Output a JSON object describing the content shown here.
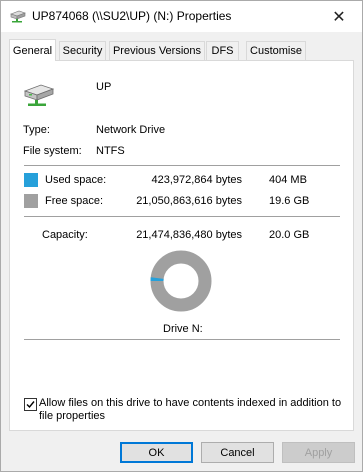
{
  "window": {
    "title": "UP874068 (\\\\SU2\\UP) (N:) Properties",
    "close_glyph": "✕"
  },
  "tabs": [
    {
      "label": "General",
      "active": true
    },
    {
      "label": "Security"
    },
    {
      "label": "Previous Versions"
    },
    {
      "label": "DFS"
    },
    {
      "label": "Customise"
    }
  ],
  "drive": {
    "name": "UP",
    "type_label": "Type:",
    "type_value": "Network Drive",
    "fs_label": "File system:",
    "fs_value": "NTFS"
  },
  "space": {
    "used": {
      "label": "Used space:",
      "bytes": "423,972,864 bytes",
      "short": "404 MB",
      "color": "#26a0da"
    },
    "free": {
      "label": "Free space:",
      "bytes": "21,050,863,616 bytes",
      "short": "19.6 GB",
      "color": "#a0a0a0"
    },
    "capacity": {
      "label": "Capacity:",
      "bytes": "21,474,836,480 bytes",
      "short": "20.0 GB"
    },
    "used_fraction": 0.0197
  },
  "drive_label": "Drive N:",
  "index_option": {
    "checked": true,
    "label_line1": "Allow files on this drive to have contents indexed in addition to",
    "label_line2": "file properties"
  },
  "buttons": {
    "ok": "OK",
    "cancel": "Cancel",
    "apply": "Apply"
  }
}
